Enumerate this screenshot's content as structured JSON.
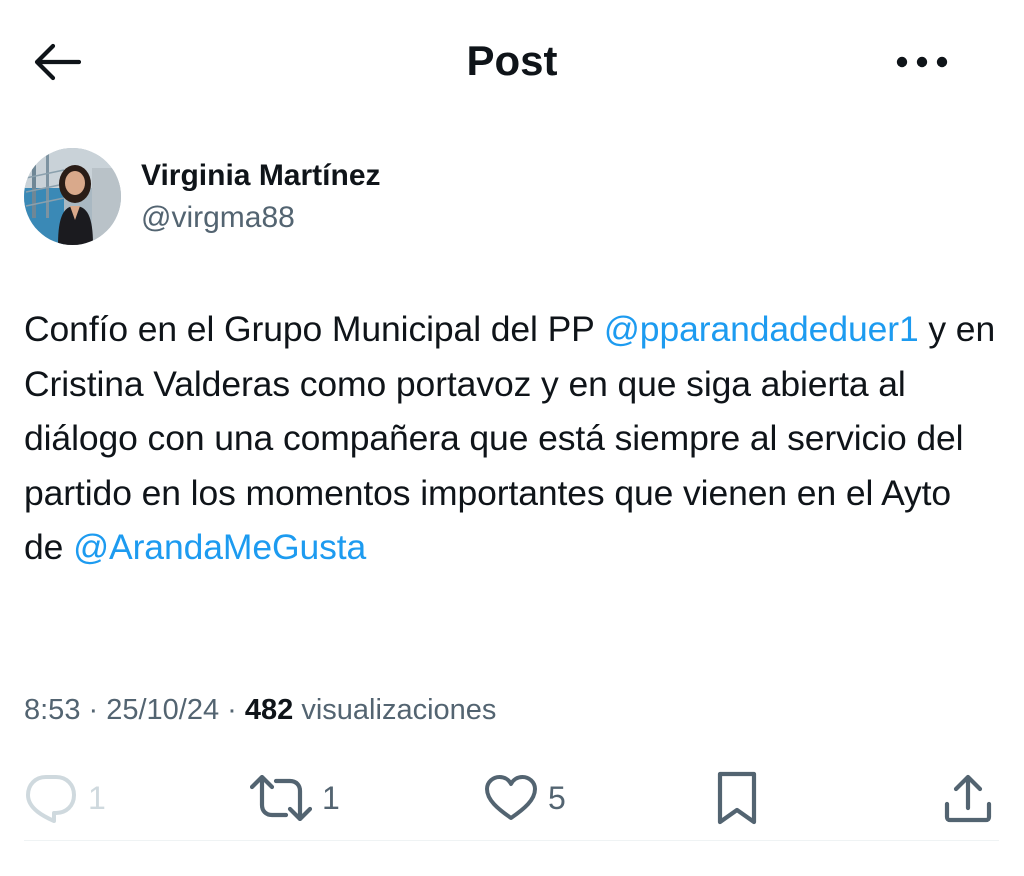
{
  "header": {
    "title": "Post",
    "back_icon": "arrow-left-icon",
    "more_icon": "ellipsis-icon"
  },
  "author": {
    "name": "Virginia Martínez",
    "handle": "@virgma88"
  },
  "tweet": {
    "part1": "Confío en el Grupo Municipal del PP ",
    "mention1": "@pparandadeduer1",
    "part2": " y en Cristina Valderas como portavoz y en que siga abierta al diálogo con una compañera que está siempre al servicio del partido en los momentos importantes que vienen en el Ayto de ",
    "mention2": "@ArandaMeGusta"
  },
  "meta": {
    "time": "8:53",
    "separator": " · ",
    "date": "25/10/24",
    "views_count": "482",
    "views_label": " visualizaciones"
  },
  "actions": {
    "reply_count": "1",
    "retweet_count": "1",
    "like_count": "5"
  },
  "colors": {
    "accent": "#1d9bf0",
    "text": "#0f1419",
    "secondary": "#536471",
    "disabled": "#cfd9de"
  }
}
